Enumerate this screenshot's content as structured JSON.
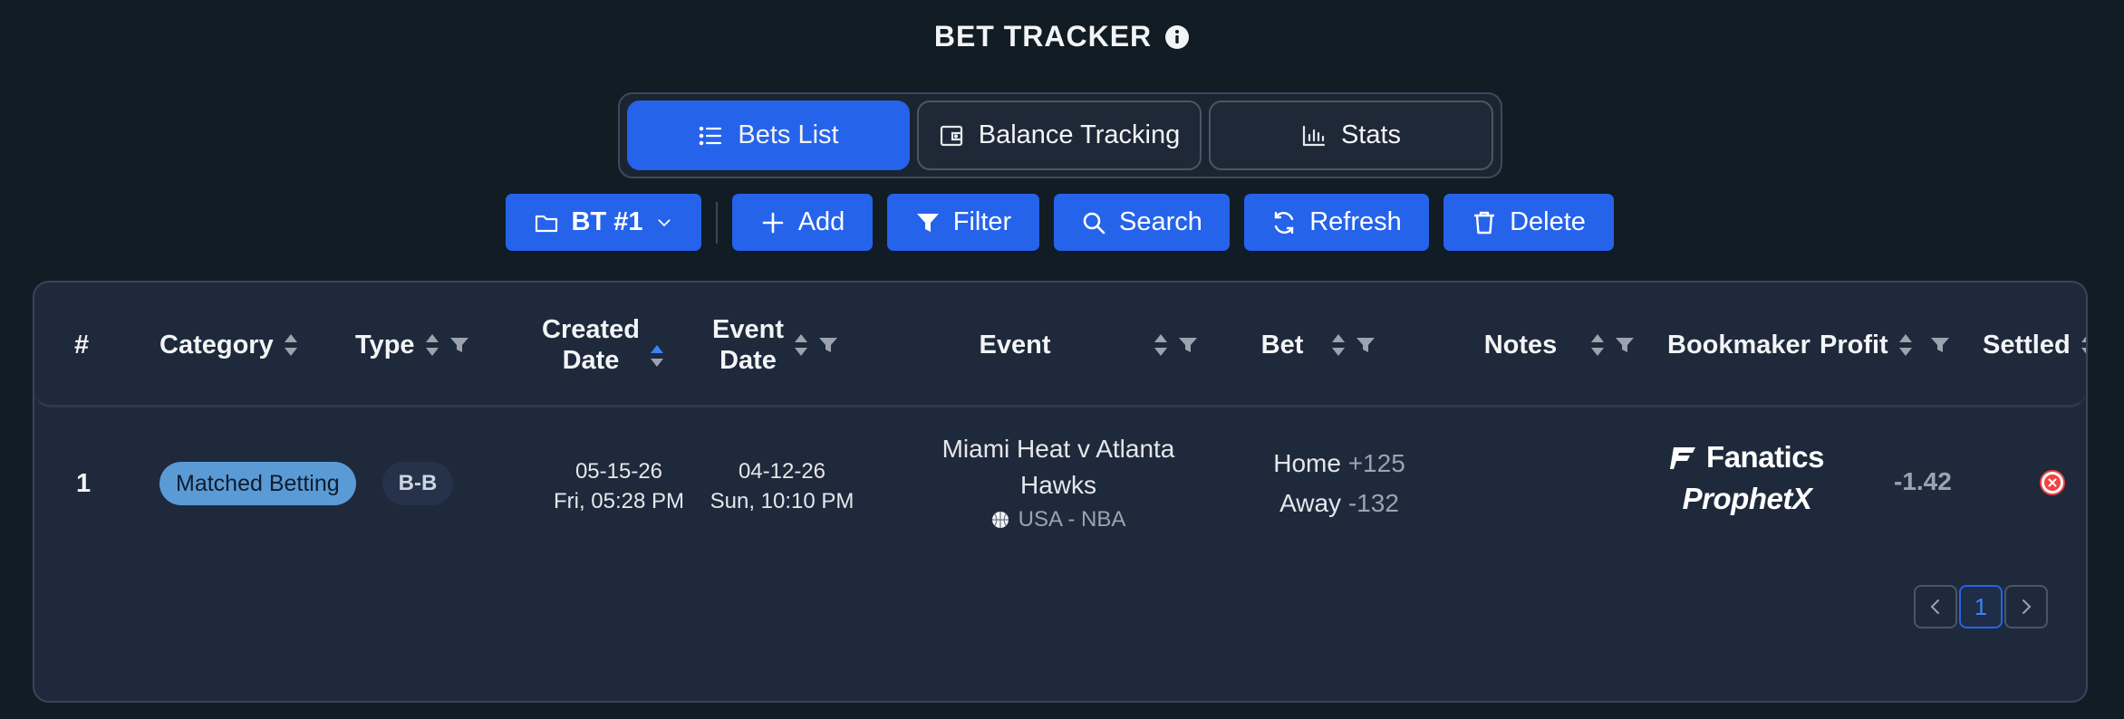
{
  "header": {
    "title": "BET TRACKER"
  },
  "tabs": [
    {
      "label": "Bets List",
      "icon": "list-icon",
      "active": true
    },
    {
      "label": "Balance Tracking",
      "icon": "wallet-icon",
      "active": false
    },
    {
      "label": "Stats",
      "icon": "bar-chart-icon",
      "active": false
    }
  ],
  "toolbar": {
    "tracker_label": "BT #1",
    "add_label": "Add",
    "filter_label": "Filter",
    "search_label": "Search",
    "refresh_label": "Refresh",
    "delete_label": "Delete"
  },
  "table": {
    "columns": {
      "num": "#",
      "category": "Category",
      "type": "Type",
      "created_1": "Created",
      "created_2": "Date",
      "event_date_1": "Event",
      "event_date_2": "Date",
      "event": "Event",
      "bet": "Bet",
      "notes": "Notes",
      "bookmaker": "Bookmaker",
      "profit": "Profit",
      "settled": "Settled"
    },
    "rows": [
      {
        "num": "1",
        "category": "Matched Betting",
        "type": "B-B",
        "created_date": "05-15-26",
        "created_time": "Fri, 05:28 PM",
        "event_date": "04-12-26",
        "event_time": "Sun, 10:10 PM",
        "event_line1": "Miami Heat v Atlanta",
        "event_line2": "Hawks",
        "league": "USA - NBA",
        "bet_home_label": "Home",
        "bet_home_odds": "+125",
        "bet_away_label": "Away",
        "bet_away_odds": "-132",
        "notes": "",
        "bookmaker_1": "Fanatics",
        "bookmaker_2": "ProphetX",
        "profit": "-1.42",
        "settled": false
      }
    ]
  },
  "pagination": {
    "current": "1"
  },
  "colors": {
    "background": "#111c24",
    "accent": "#2563eb",
    "card": "#1e293b",
    "category_badge": "#5b9bd5",
    "unsettled": "#ef4444"
  }
}
